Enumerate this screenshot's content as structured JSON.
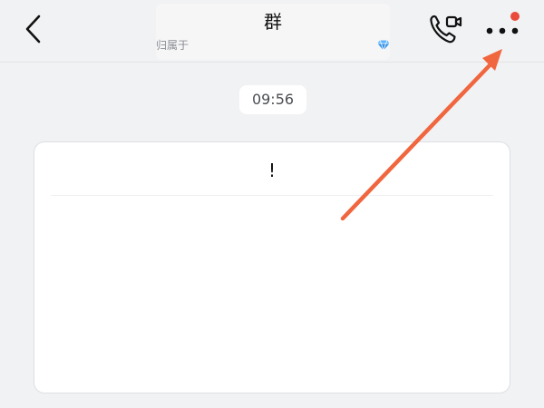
{
  "header": {
    "title": "群",
    "subtitle": "归属于",
    "back_icon": "chevron-left-icon",
    "call_icon": "phone-video-icon",
    "more_icon": "more-horizontal-icon",
    "diamond_icon": "diamond-icon",
    "notification_dot_color": "#e94b3c"
  },
  "chat": {
    "timestamp": "09:56",
    "card_title": "!"
  },
  "annotation": {
    "arrow_color": "#f0663f",
    "arrow_target": "more-button"
  }
}
